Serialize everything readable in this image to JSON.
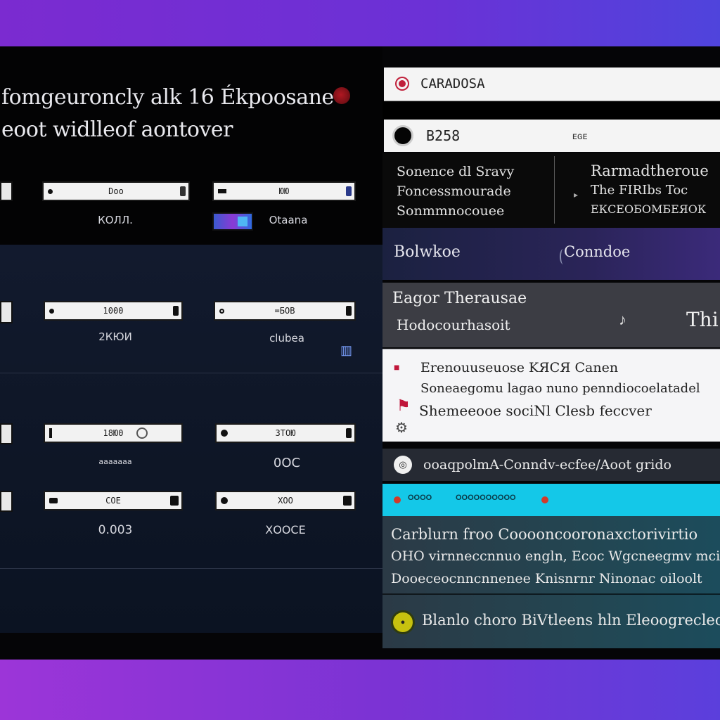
{
  "hero": {
    "line1": "fomgeuroncly alk 16 Ékpoosane",
    "line2": "eoot widlleof aontover"
  },
  "left_fields": {
    "row1": {
      "field_a": "Doo",
      "field_b": "ЮЮ",
      "label_a": "КОЛЛ.",
      "label_b": "Otaana"
    },
    "row2": {
      "field_a": "1000",
      "field_b": "=БОВ",
      "label_a": "2КЮИ",
      "label_b": "clubea"
    },
    "row3": {
      "field_a": "18Ю0",
      "field_b": "ЗТОЮ",
      "label_a": "ааааааа",
      "label_b": "0OC"
    },
    "row4": {
      "field_a": "СОЕ",
      "field_b": "ХОО",
      "label_a": "0.003",
      "label_b": "ХООСЕ"
    }
  },
  "right": {
    "search_text": "CARADOSA",
    "id_text": "B258",
    "id_meta": "ᴇɢᴇ",
    "col1": [
      "Sonence dl Sravy",
      "Foncessmourade",
      "Sonmmnocouee"
    ],
    "col2": [
      "Rarmadtheroue",
      "The FIRIbs Toc",
      "ЕКСЕОБОМБЕЯОК"
    ],
    "nav_a": "Bolwkoe",
    "nav_b": "Conndoe",
    "gray_l1": "Eagor Therausae",
    "gray_l2": "Hodocourhasoit",
    "gray_end": "Thi",
    "white_l1": "Erenouuseuose KЯСЯ Canen",
    "white_l2": "Soneaegomu lagao nuno penndiocoelatadel",
    "white_l3": "Shemeeooe sociNl Clesb feccver",
    "tag_text": "ooaqpolmA-Conndv-ecfee/Aoot grido",
    "cyan_lbl1": "ОООО",
    "cyan_lbl2": "ОООООООООО",
    "teal_p1": "Carblurn froo Cooooncooronaxctorivirtio",
    "teal_p2": "ОНО virnneccnnuo engln, Ecoc Wgcneegmv mcid",
    "teal_p3": "Dooeceocnncnnenee Knisnrnr Ninonac oiloolt",
    "teal_p4": "Blanlo choro BiVtleens hln Eleoogrecleo"
  },
  "colors": {
    "accent_red": "#c0163a",
    "cyan_bar": "#14c8e8",
    "coin_yellow": "#c7c10f"
  },
  "icons": [
    "record-icon",
    "search-icon",
    "avatar-icon",
    "pin-icon",
    "settings-icon",
    "coin-icon"
  ]
}
